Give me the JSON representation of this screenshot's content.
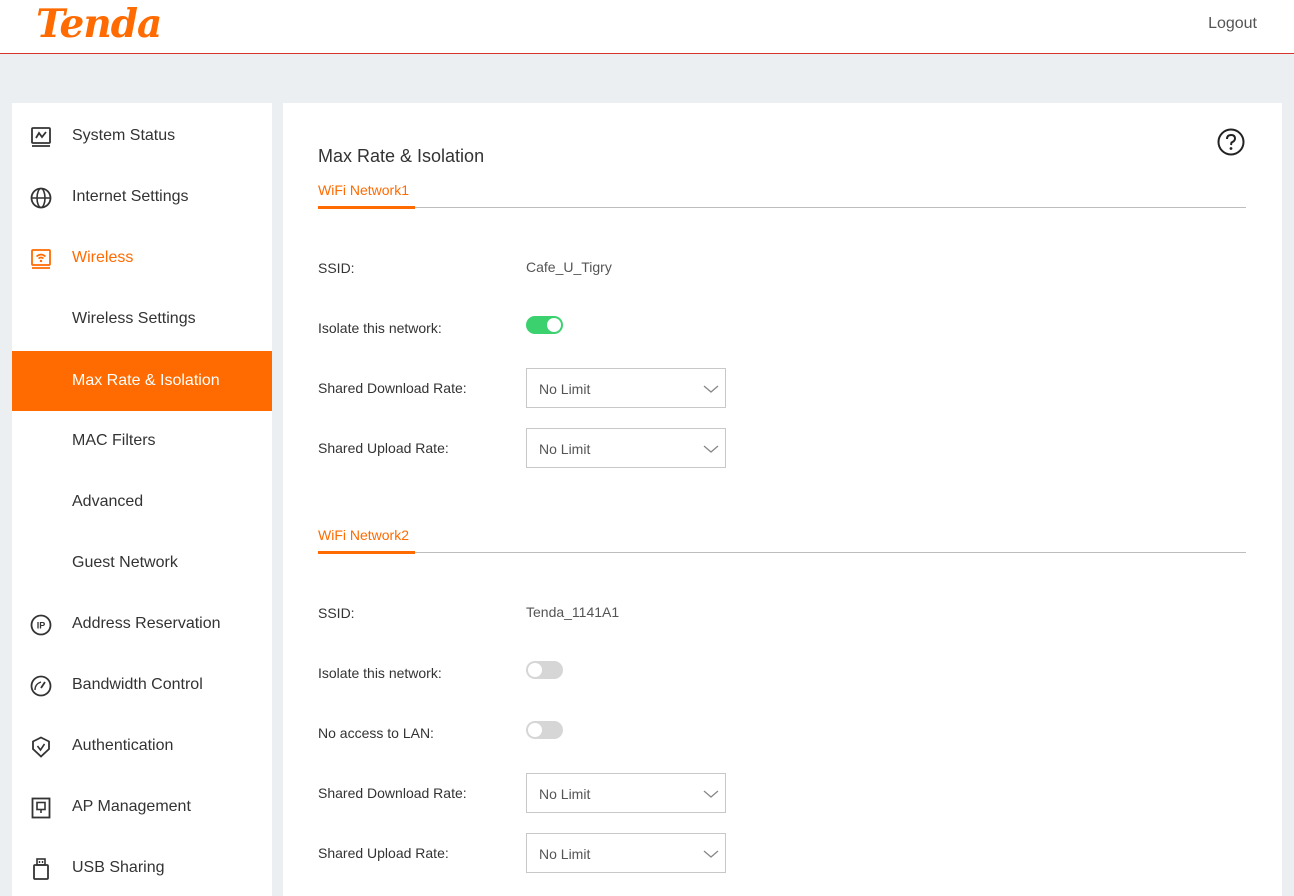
{
  "header": {
    "logo": "Tenda",
    "logout": "Logout"
  },
  "sidebar": {
    "items": [
      {
        "label": "System Status"
      },
      {
        "label": "Internet Settings"
      },
      {
        "label": "Wireless"
      },
      {
        "label": "Wireless Settings"
      },
      {
        "label": "Max Rate & Isolation"
      },
      {
        "label": "MAC Filters"
      },
      {
        "label": "Advanced"
      },
      {
        "label": "Guest Network"
      },
      {
        "label": "Address Reservation"
      },
      {
        "label": "Bandwidth Control"
      },
      {
        "label": "Authentication"
      },
      {
        "label": "AP Management"
      },
      {
        "label": "USB Sharing"
      }
    ],
    "active_item": "Max Rate & Isolation",
    "expanded_group": "Wireless"
  },
  "page": {
    "title": "Max Rate & Isolation"
  },
  "network1": {
    "tab": "WiFi Network1",
    "ssid_label": "SSID:",
    "ssid": "Cafe_U_Tigry",
    "isolate_label": "Isolate this network:",
    "isolate_on": true,
    "download_label": "Shared Download Rate:",
    "download_value": "No Limit",
    "upload_label": "Shared Upload Rate:",
    "upload_value": "No Limit"
  },
  "network2": {
    "tab": "WiFi Network2",
    "ssid_label": "SSID:",
    "ssid": "Tenda_1141A1",
    "isolate_label": "Isolate this network:",
    "isolate_on": false,
    "lan_label": "No access to LAN:",
    "lan_on": false,
    "download_label": "Shared Download Rate:",
    "download_value": "No Limit",
    "upload_label": "Shared Upload Rate:",
    "upload_value": "No Limit"
  },
  "colors": {
    "accent": "#ff6b00",
    "toggle_on": "#3bd16f",
    "toggle_off": "#d6d6d6"
  }
}
